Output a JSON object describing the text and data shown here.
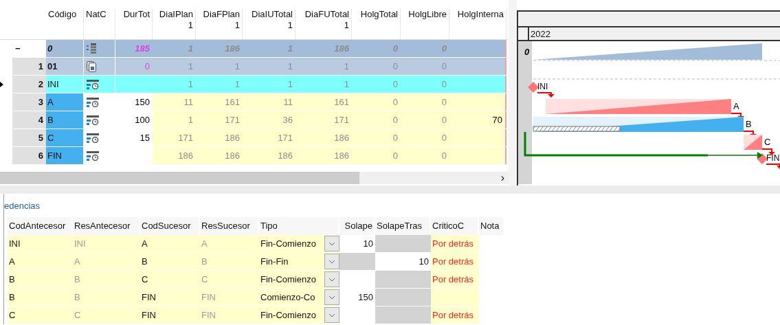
{
  "grid": {
    "columns": [
      {
        "label": "Código"
      },
      {
        "label": "NatC"
      },
      {
        "label": "DurTot"
      },
      {
        "label": "DiaIPlan",
        "sub": "1"
      },
      {
        "label": "DiaFPlan",
        "sub": "1"
      },
      {
        "label": "DiaIUTotal",
        "sub": "1"
      },
      {
        "label": "DiaFUTotal",
        "sub": "1"
      },
      {
        "label": "HolgTotal"
      },
      {
        "label": "HolgLibre"
      },
      {
        "label": "HolgInterna"
      }
    ],
    "rows": [
      {
        "kind": "summary",
        "selected": false,
        "toggle": "−",
        "cells": [
          "0",
          null,
          "185",
          "1",
          "186",
          "1",
          "186",
          "0",
          "0",
          null
        ]
      },
      {
        "kind": "group",
        "selected": false,
        "number": "1",
        "cells": [
          "01",
          null,
          "0",
          "1",
          "1",
          "1",
          "1",
          "0",
          "0",
          null
        ]
      },
      {
        "kind": "milestone",
        "selected": true,
        "number": "2",
        "cells": [
          "INI",
          null,
          null,
          "1",
          "1",
          "1",
          "1",
          "0",
          "0",
          null
        ]
      },
      {
        "kind": "task",
        "selected": false,
        "number": "3",
        "cells": [
          "A",
          null,
          "150",
          "11",
          "161",
          "11",
          "161",
          "0",
          "0",
          null
        ]
      },
      {
        "kind": "task",
        "selected": false,
        "number": "4",
        "cells": [
          "B",
          null,
          "100",
          "1",
          "171",
          "36",
          "171",
          "0",
          "0",
          "70"
        ]
      },
      {
        "kind": "task",
        "selected": false,
        "number": "5",
        "cells": [
          "C",
          null,
          "15",
          "171",
          "186",
          "171",
          "186",
          "0",
          "0",
          null
        ]
      },
      {
        "kind": "task",
        "selected": false,
        "number": "6",
        "cells": [
          "FIN",
          null,
          null,
          "186",
          "186",
          "186",
          "186",
          "0",
          "0",
          null
        ]
      }
    ],
    "scroll_arrow": "›"
  },
  "gantt": {
    "year": "2022",
    "bars": [
      {
        "kind": "summary",
        "label": "0",
        "baseline": false
      },
      {
        "kind": "milestone",
        "label": "INI",
        "baseline": false
      },
      {
        "kind": "task",
        "label": "A",
        "baseline": false
      },
      {
        "kind": "task",
        "label": "B",
        "baseline": true
      },
      {
        "kind": "task",
        "label": "C",
        "baseline": false
      },
      {
        "kind": "milestone",
        "label": "FIN",
        "baseline": false
      }
    ]
  },
  "precedences": {
    "title": "edencias",
    "columns": [
      "CodAntecesor",
      "ResAntecesor",
      "CodSucesor",
      "ResSucesor",
      "Tipo",
      "Solape",
      "SolapeTras",
      "CriticoC",
      "Nota"
    ],
    "rows": [
      {
        "cod_ant": "INI",
        "res_ant": "INI",
        "cod_suc": "A",
        "res_suc": "A",
        "tipo": "Fin-Comienzo",
        "solape": "10",
        "solape_disabled": false,
        "solape_tras_disabled": true,
        "critico": "Por detrás"
      },
      {
        "cod_ant": "A",
        "res_ant": "A",
        "cod_suc": "B",
        "res_suc": "B",
        "tipo": "Fin-Fin",
        "solape_tras": "10",
        "solape_disabled": true,
        "solape_tras_disabled": false,
        "critico": "Por detrás"
      },
      {
        "cod_ant": "B",
        "res_ant": "B",
        "cod_suc": "C",
        "res_suc": "C",
        "tipo": "Fin-Comienzo",
        "solape_disabled": false,
        "solape_tras_disabled": true,
        "critico": "Por detrás"
      },
      {
        "cod_ant": "B",
        "res_ant": "B",
        "cod_suc": "FIN",
        "res_suc": "FIN",
        "tipo": "Comienzo-Co",
        "solape": "150",
        "solape_disabled": false,
        "solape_tras_disabled": true
      },
      {
        "cod_ant": "C",
        "res_ant": "C",
        "cod_suc": "FIN",
        "res_suc": "FIN",
        "tipo": "Fin-Comienzo",
        "solape_disabled": false,
        "solape_tras_disabled": true,
        "critico": "Por detrás"
      }
    ]
  }
}
